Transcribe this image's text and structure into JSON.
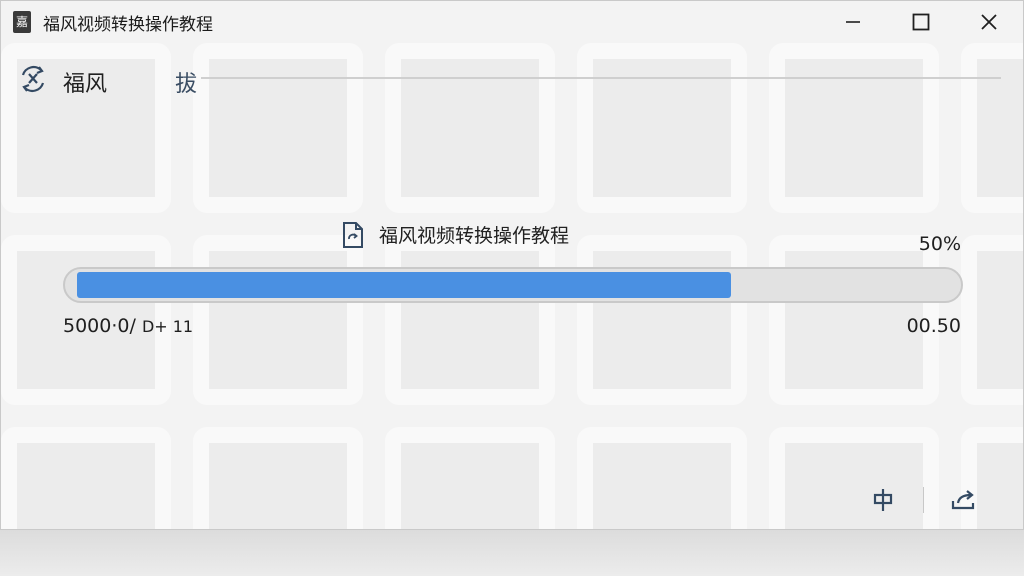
{
  "window": {
    "title": "福风视频转换操作教程",
    "app_icon_glyph": "嘉",
    "controls": {
      "minimize": "minimize-icon",
      "maximize": "maximize-icon",
      "close": "close-icon"
    }
  },
  "toolbar": {
    "brand_text": "福风",
    "tab_label": "拔"
  },
  "task": {
    "file_name": "福风视频转换操作教程",
    "percent_text": "50%",
    "progress_fraction": 0.75,
    "left_stat_main": "5000·0/ ",
    "left_stat_small": "D+ 11",
    "right_stat": "00.50"
  },
  "actions": {
    "left_icon": "pin-icon",
    "right_icon": "share-icon"
  },
  "colors": {
    "progress": "#4a90e2",
    "accent_text": "#3a4d63",
    "icon": "#344a63"
  }
}
